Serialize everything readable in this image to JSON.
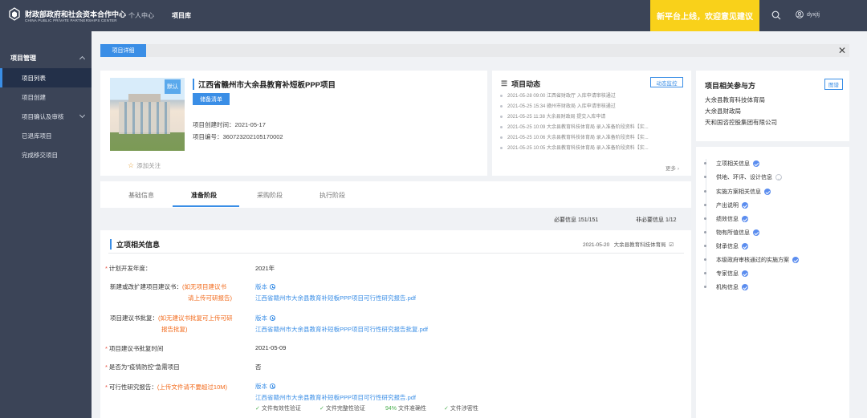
{
  "header": {
    "brand_cn": "财政部政府和社会资本合作中心",
    "brand_en": "CHINA PUBLIC PRIVATE PARTNERSHIPS CENTER",
    "logo_text": "CPPPC",
    "nav": [
      "个人中心",
      "项目库"
    ],
    "banner": "新平台上线，欢迎意见建议",
    "user": "dyxjtj"
  },
  "sidebar": {
    "group": "项目管理",
    "items": [
      {
        "label": "项目列表",
        "active": true
      },
      {
        "label": "项目创建"
      },
      {
        "label": "项目确认及审核"
      },
      {
        "label": "已退库项目"
      },
      {
        "label": "完成移交项目"
      }
    ]
  },
  "page_tab": "项目详细",
  "project": {
    "badge": "默认",
    "title": "江西省赣州市大余县教育补短板PPP项目",
    "prep_button": "储备清单",
    "created": "项目创建时间：2021-05-17",
    "code": "项目编号：360723202105170002",
    "follow": "添加关注"
  },
  "dynamics": {
    "title": "项目动态",
    "monitor": "动态监控",
    "items": [
      "2021-05-28 09:00   江西省财政厅   入库申请审核通过",
      "2021-05-25 15:34   赣州市财政局   入库申请审核通过",
      "2021-05-25 11:38   大余县财政局   提交入库申请",
      "2021-05-25 10:09   大余县教育科技体育局   录入准备阶段资料【实...",
      "2021-05-25 10:06   大余县教育科技体育局   录入准备阶段资料【实...",
      "2021-05-25 10:05   大余县教育科技体育局   录入准备阶段资料【实..."
    ],
    "more": "更多"
  },
  "parties": {
    "title": "项目相关参与方",
    "view": "图谱",
    "list": [
      "大余县教育科技体育局",
      "大余县财政局",
      "天和国咨控股集团有限公司"
    ]
  },
  "progress": [
    {
      "label": "立项相关信息",
      "done": true
    },
    {
      "label": "供地、环评、设计信息",
      "done": false
    },
    {
      "label": "实施方案相关信息",
      "done": true
    },
    {
      "label": "产出说明",
      "done": true
    },
    {
      "label": "绩效信息",
      "done": true
    },
    {
      "label": "物有所值信息",
      "done": true
    },
    {
      "label": "财承信息",
      "done": true
    },
    {
      "label": "本级政府审核通过的实施方案",
      "done": true
    },
    {
      "label": "专家信息",
      "done": true
    },
    {
      "label": "机构信息",
      "done": true
    }
  ],
  "stage_tabs": [
    "基础信息",
    "准备阶段",
    "采购阶段",
    "执行阶段"
  ],
  "counts": {
    "required": "必要信息 151/151",
    "optional": "非必要信息 1/12"
  },
  "section": {
    "title": "立项相关信息",
    "date": "2021-05-20",
    "org": "大余县教育科技体育局"
  },
  "fields": {
    "plan_year_label": "计划开发年度：",
    "plan_year": "2021年",
    "proposal_label": "新建或改扩建项目建议书：",
    "proposal_hint_1": "(如无项目建议书",
    "proposal_hint_2": "请上传可研报告)",
    "version": "版本",
    "proposal_file": "江西省赣州市大余县教育补短板PPP项目可行性研究报告.pdf",
    "approval_label": "项目建议书批复：",
    "approval_hint_1": "(如无建议书批复可上传可研",
    "approval_hint_2": "报告批复)",
    "approval_file": "江西省赣州市大余县教育补短板PPP项目可行性研究报告批复.pdf",
    "approval_time_label": "项目建议书批复时间",
    "approval_time": "2021-05-09",
    "epidemic_label": "是否为\"疫情防控\"急需项目",
    "epidemic": "否",
    "feasibility_label": "可行性研究报告：",
    "feasibility_hint": "(上传文件请不要超过10M)",
    "feasibility_file": "江西省赣州市大余县教育补短板PPP项目可行性研究报告.pdf",
    "verify_1": "文件有效性验证",
    "verify_2": "文件完整性验证",
    "verify_pct": "94%",
    "verify_3": "文件准确性",
    "verify_4": "文件涉密性"
  }
}
